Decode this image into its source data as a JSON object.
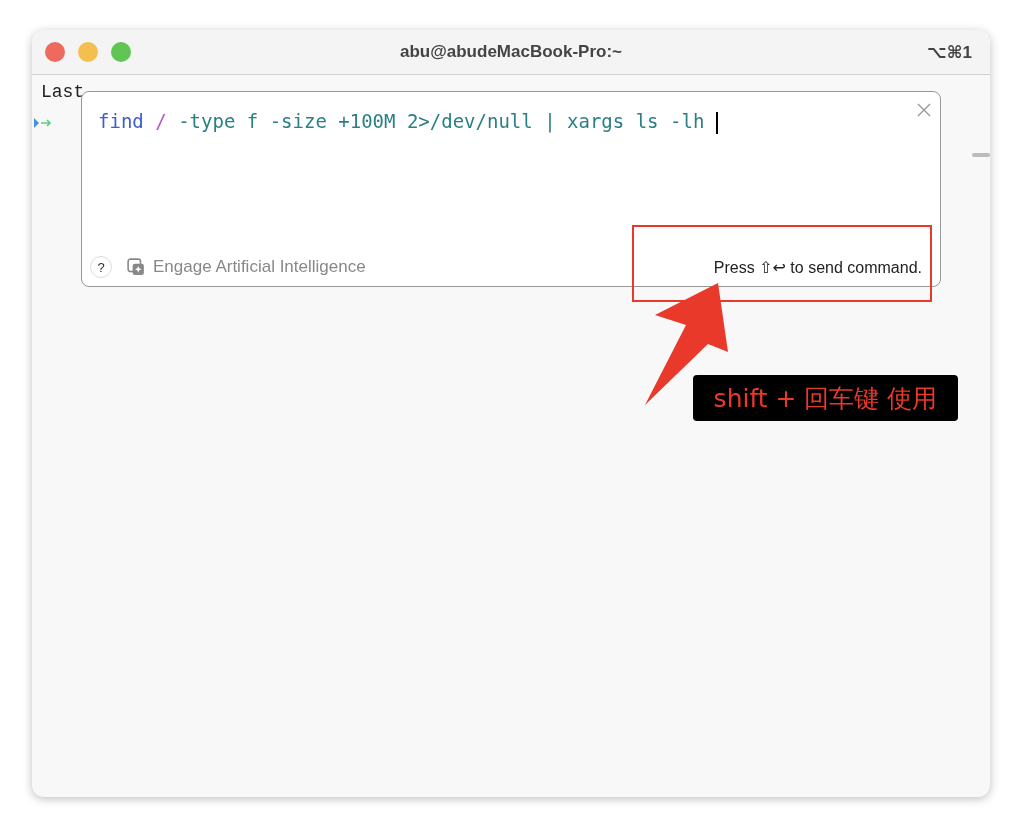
{
  "window": {
    "title": "abu@abudeMacBook-Pro:~",
    "shortcut": "⌥⌘1"
  },
  "terminal": {
    "lines": [
      "Last"
    ]
  },
  "command_editor": {
    "tokens": [
      {
        "text": "find",
        "kind": "command"
      },
      {
        "text": "/",
        "kind": "path"
      },
      {
        "text": "-type f -size +100M 2>/dev/null | xargs ls -lh",
        "kind": "argument"
      }
    ],
    "help": "?",
    "ai_label": "Engage Artificial Intelligence",
    "hint": "Press ⇧↩ to send command."
  },
  "annotation": {
    "label": "shift + 回车键 使用"
  }
}
